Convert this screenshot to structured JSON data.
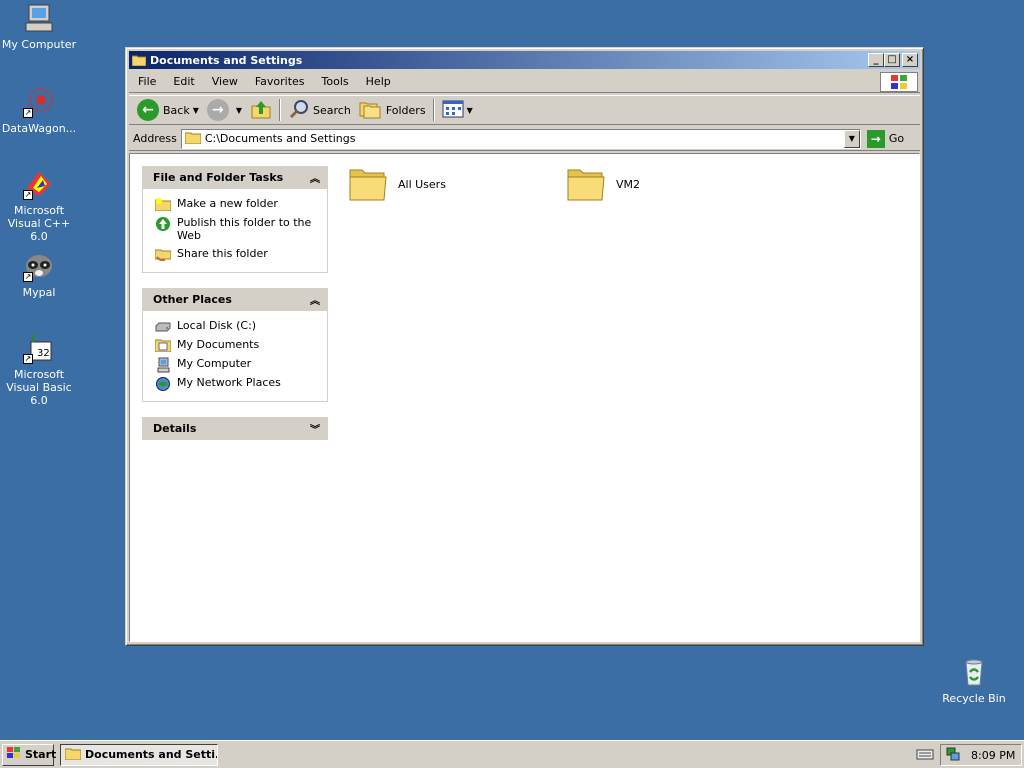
{
  "desktop": {
    "icons": [
      {
        "label": "My Computer"
      },
      {
        "label": "DataWagon..."
      },
      {
        "label": "Microsoft Visual C++ 6.0"
      },
      {
        "label": "Mypal"
      },
      {
        "label": "Microsoft Visual Basic 6.0"
      },
      {
        "label": "Recycle Bin"
      }
    ]
  },
  "window": {
    "title": "Documents and Settings",
    "menu": [
      "File",
      "Edit",
      "View",
      "Favorites",
      "Tools",
      "Help"
    ],
    "toolbar": {
      "back": "Back",
      "search": "Search",
      "folders": "Folders"
    },
    "address": {
      "label": "Address",
      "value": "C:\\Documents and Settings",
      "go": "Go"
    },
    "taskpane": {
      "file_folder_tasks": {
        "title": "File and Folder Tasks",
        "items": [
          "Make a new folder",
          "Publish this folder to the Web",
          "Share this folder"
        ]
      },
      "other_places": {
        "title": "Other Places",
        "items": [
          "Local Disk (C:)",
          "My Documents",
          "My Computer",
          "My Network Places"
        ]
      },
      "details": {
        "title": "Details"
      }
    },
    "folders": [
      "All Users",
      "VM2"
    ]
  },
  "taskbar": {
    "start": "Start",
    "task": "Documents and Setti...",
    "clock": "8:09 PM"
  },
  "colors": {
    "desktop": "#3a6ea5",
    "title_active": "#0a246a",
    "folder": "#f5d66b"
  }
}
